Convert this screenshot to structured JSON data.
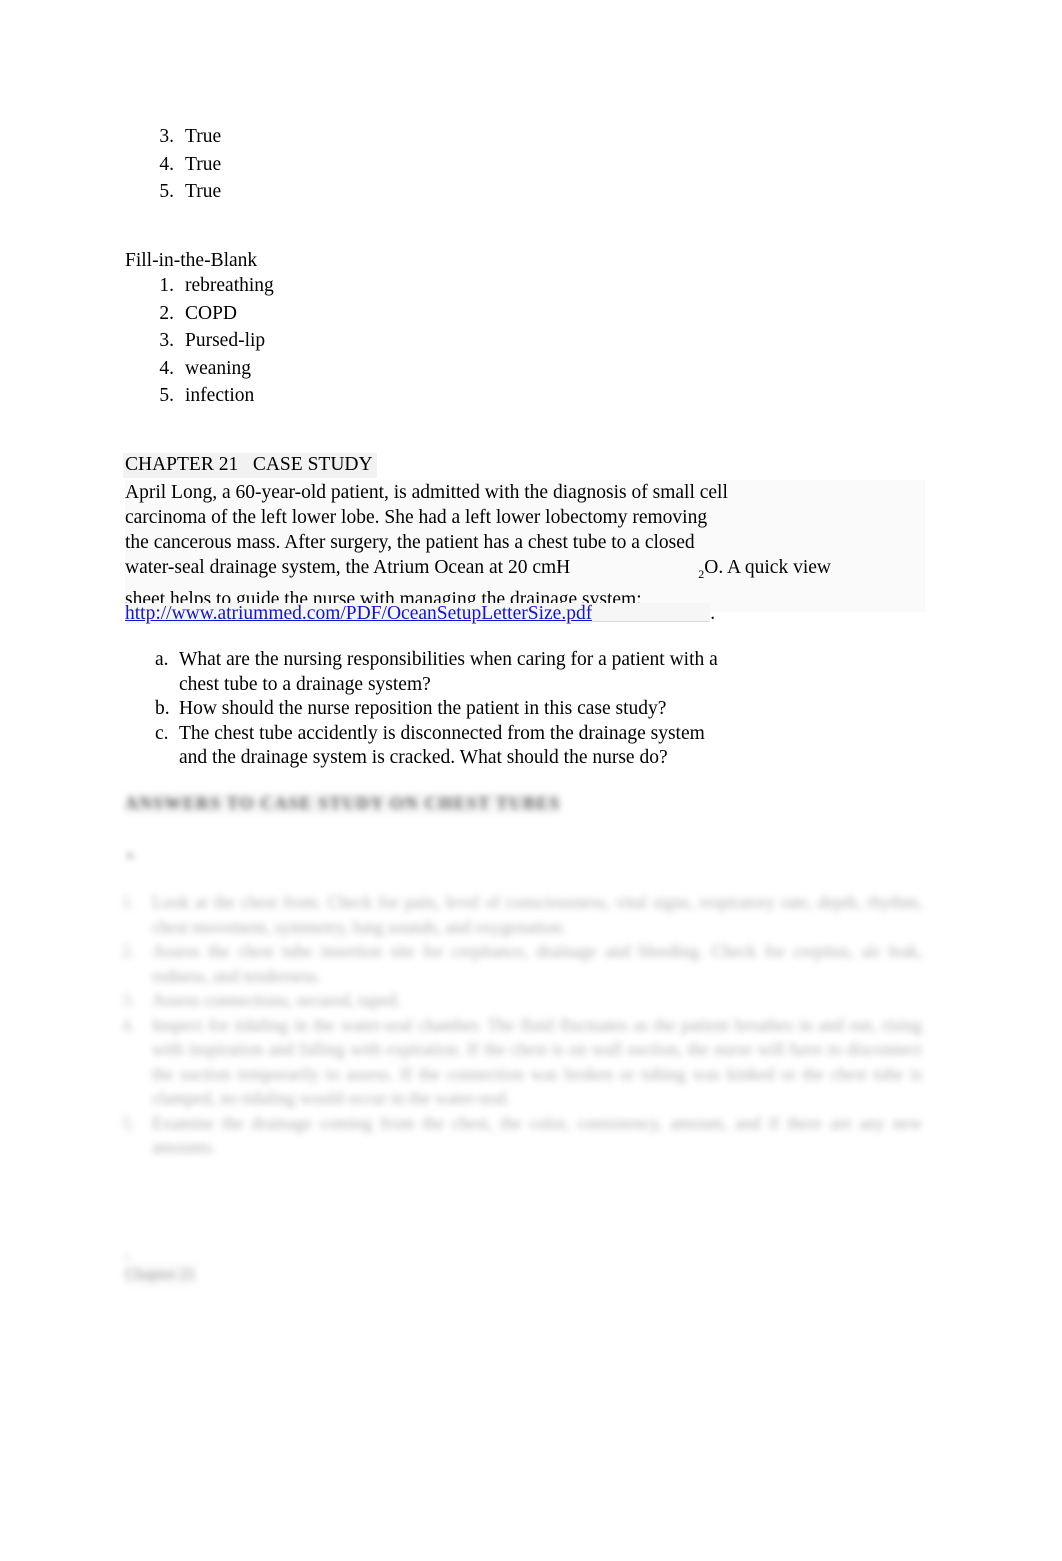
{
  "document": {
    "true_false_answers": {
      "items": [
        {
          "marker": "3.",
          "text": "True"
        },
        {
          "marker": "4.",
          "text": "True"
        },
        {
          "marker": "5.",
          "text": "True"
        }
      ]
    },
    "fill_in_the_blank": {
      "heading": "Fill-in-the-Blank",
      "items": [
        {
          "marker": "1.",
          "text": "rebreathing"
        },
        {
          "marker": "2.",
          "text": "COPD"
        },
        {
          "marker": "3.",
          "text": "Pursed-lip"
        },
        {
          "marker": "4.",
          "text": "weaning"
        },
        {
          "marker": "5.",
          "text": "infection"
        }
      ]
    },
    "case_study": {
      "heading": "CHAPTER 21   CASE STUDY",
      "paragraph_lines": [
        "April Long, a 60-year-old patient, is admitted with the diagnosis of small cell",
        "carcinoma of the left lower lobe. She had a left lower lobectomy removing",
        "the cancerous mass. After surgery, the patient has a chest tube to a closed"
      ],
      "line_with_subscript": {
        "before": "water-seal drainage system, the Atrium Ocean at 20 cmH",
        "subscript": "2",
        "after": "O. A quick view"
      },
      "line_after_subscript": "sheet helps to guide the nurse with managing the drainage system:",
      "url": "http://www.atriummed.com/PDF/OceanSetupLetterSize.pdf",
      "url_trailing_period": ".",
      "questions": [
        {
          "marker": "a.",
          "line1": "What are the nursing responsibilities when caring for a patient with a",
          "line2": "chest tube to a drainage system?"
        },
        {
          "marker": "b.",
          "line1": "How should the nurse reposition the patient in this case study?",
          "line2": ""
        },
        {
          "marker": "c.",
          "line1": "The chest tube accidently is disconnected from the drainage system",
          "line2": "and the drainage system is cracked. What should the nurse do?"
        }
      ]
    },
    "answers_section": {
      "heading": "ANSWERS TO CASE STUDY ON CHEST TUBES",
      "small_mark": "a.",
      "items": [
        {
          "marker": "1.",
          "text": "Look at the chest from. Check for pain, level of consciousness, vital signs, respiratory rate, depth, rhythm, chest movement, symmetry, lung sounds, and oxygenation."
        },
        {
          "marker": "2.",
          "text": "Assess the chest tube insertion site for crepitance, drainage and bleeding. Check for crepitus, air leak, redness, and tenderness."
        },
        {
          "marker": "3.",
          "text": "Assess connections, secured, taped."
        },
        {
          "marker": "4.",
          "text": "Inspect for tidaling in the water-seal chamber. The fluid fluctuates as the patient breathes in and out, rising with inspiration and falling with expiration. If the chest is on wall suction, the nurse will have to disconnect the suction temporarily to assess. If the connection was broken or tubing was kinked or the chest tube is clamped, no tidaling would occur in the water-seal."
        },
        {
          "marker": "5.",
          "text": "Examine the drainage coming from the chest, the color, consistency, amount, and if there are any new amounts."
        }
      ]
    },
    "footer": {
      "line1": "1",
      "line2": "Chapter 21"
    }
  }
}
